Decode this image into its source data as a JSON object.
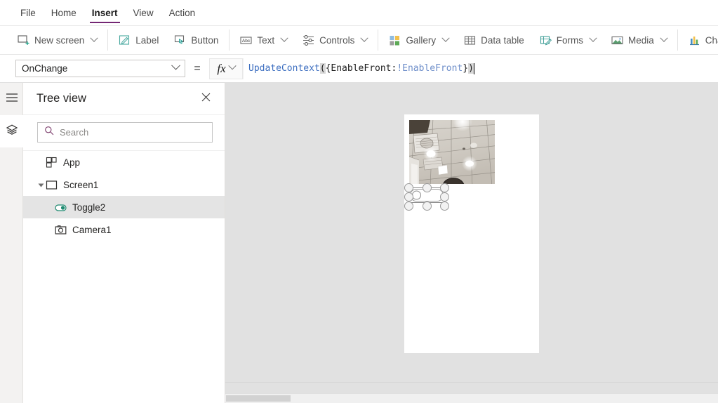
{
  "menu": {
    "tabs": [
      {
        "label": "File",
        "active": false
      },
      {
        "label": "Home",
        "active": false
      },
      {
        "label": "Insert",
        "active": true
      },
      {
        "label": "View",
        "active": false
      },
      {
        "label": "Action",
        "active": false
      }
    ],
    "active_tab": "Insert",
    "accent_color": "#742774"
  },
  "ribbon": {
    "items": [
      {
        "label": "New screen",
        "icon": "new-screen-icon",
        "has_caret": true
      },
      {
        "label": "Label",
        "icon": "label-icon",
        "has_caret": false
      },
      {
        "label": "Button",
        "icon": "button-icon",
        "has_caret": false
      },
      {
        "label": "Text",
        "icon": "text-icon",
        "has_caret": true
      },
      {
        "label": "Controls",
        "icon": "controls-icon",
        "has_caret": true
      },
      {
        "label": "Gallery",
        "icon": "gallery-icon",
        "has_caret": true
      },
      {
        "label": "Data table",
        "icon": "data-table-icon",
        "has_caret": false
      },
      {
        "label": "Forms",
        "icon": "forms-icon",
        "has_caret": true
      },
      {
        "label": "Media",
        "icon": "media-icon",
        "has_caret": true
      },
      {
        "label": "Chart",
        "icon": "chart-icon",
        "has_caret": false
      }
    ]
  },
  "formula_bar": {
    "property": "OnChange",
    "equals": "=",
    "fx_label": "fx",
    "formula_tokens": [
      {
        "text": "UpdateContext",
        "type": "function"
      },
      {
        "text": "(",
        "type": "paren-highlight"
      },
      {
        "text": "{EnableFront:",
        "type": "punct"
      },
      {
        "text": "!EnableFront",
        "type": "identifier"
      },
      {
        "text": "}",
        "type": "punct"
      },
      {
        "text": ")",
        "type": "paren-highlight"
      }
    ],
    "formula_text": "UpdateContext({EnableFront:!EnableFront})"
  },
  "rail": {
    "buttons": [
      {
        "icon": "hamburger-menu-icon",
        "selected": false
      },
      {
        "icon": "layers-icon",
        "selected": true
      }
    ]
  },
  "tree_view": {
    "title": "Tree view",
    "close_icon": "close-icon",
    "search": {
      "placeholder": "Search",
      "value": "",
      "icon": "search-icon"
    },
    "items": [
      {
        "label": "App",
        "icon": "app-icon",
        "indent": 0,
        "selected": false,
        "expandable": false
      },
      {
        "label": "Screen1",
        "icon": "screen-icon",
        "indent": 0,
        "selected": false,
        "expandable": true,
        "expanded": true
      },
      {
        "label": "Toggle2",
        "icon": "toggle-icon",
        "indent": 1,
        "selected": true,
        "expandable": false
      },
      {
        "label": "Camera1",
        "icon": "camera-icon",
        "indent": 1,
        "selected": false,
        "expandable": false
      }
    ]
  },
  "canvas": {
    "background": "#e1e1e1",
    "screen_background": "#ffffff",
    "camera_control": {
      "name": "Camera1",
      "preview": "ceiling-tiles-with-lights"
    },
    "toggle_control": {
      "name": "Toggle2",
      "selected": true,
      "state": "off",
      "handle_count": 8
    }
  }
}
